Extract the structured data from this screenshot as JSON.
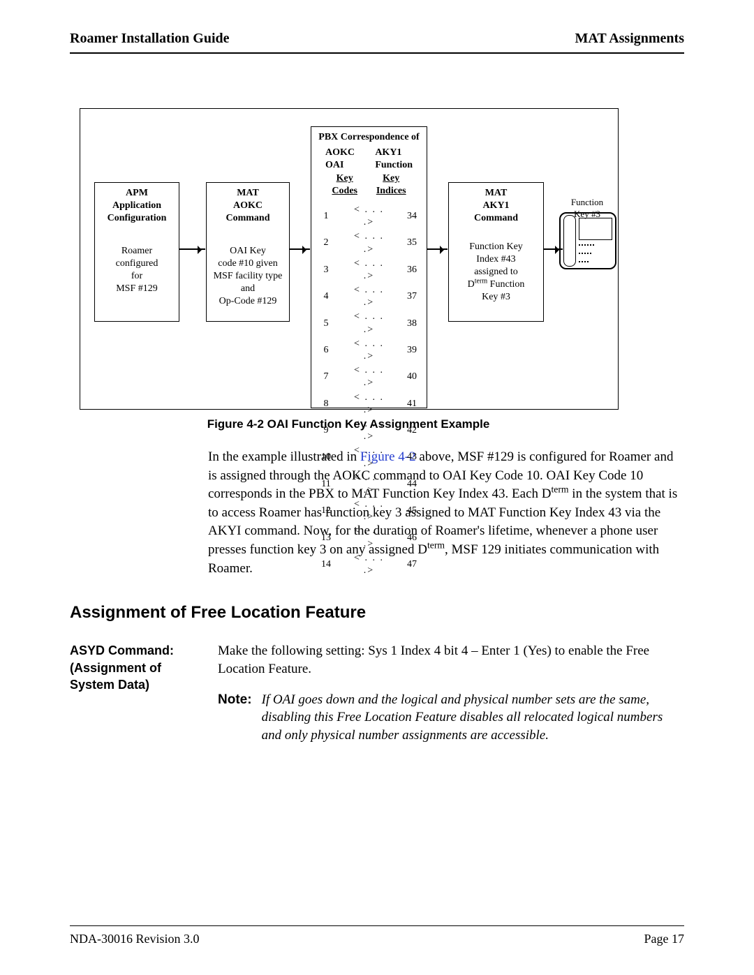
{
  "header": {
    "left": "Roamer Installation Guide",
    "right": "MAT Assignments"
  },
  "diagram": {
    "box1": {
      "t": "APM",
      "s1": "Application",
      "s2": "Configuration",
      "p1": "Roamer",
      "p2": "configured",
      "p3": "for",
      "p4": "MSF #129"
    },
    "box2": {
      "t": "MAT",
      "s1": "AOKC",
      "s2": "Command",
      "p1": "OAI Key",
      "p2": "code #10 given",
      "p3": "MSF facility type",
      "p4": "and",
      "p5": "Op-Code #129"
    },
    "box3": {
      "head": "PBX Correspondence of",
      "left_t1": "AOKC",
      "left_t2": "OAI",
      "right_t1": "AKY1",
      "right_t2": "Function",
      "left_u": "Key Codes",
      "right_u": "Key Indices",
      "rows": [
        [
          "1",
          "< . . . .>",
          "34"
        ],
        [
          "2",
          "< . . . .>",
          "35"
        ],
        [
          "3",
          "< . . . .>",
          "36"
        ],
        [
          "4",
          "< . . . .>",
          "37"
        ],
        [
          "5",
          "< . . . .>",
          "38"
        ],
        [
          "6",
          "< . . . .>",
          "39"
        ],
        [
          "7",
          "< . . . .>",
          "40"
        ],
        [
          "8",
          "< . . . .>",
          "41"
        ],
        [
          "9",
          "< . . . .>",
          "42"
        ],
        [
          "10",
          "< . . . .>",
          "43"
        ],
        [
          "11",
          "< . . . .>",
          "44"
        ],
        [
          "12",
          "< . . . .>",
          "45"
        ],
        [
          "13",
          "< . . . .>",
          "46"
        ],
        [
          "14",
          "< . . . .>",
          "47"
        ]
      ]
    },
    "box4": {
      "t": "MAT",
      "s1": "AKY1",
      "s2": "Command",
      "p1": "Function Key",
      "p2": "Index #43",
      "p3": "assigned to",
      "p4_before": "D",
      "p4_sup": "term",
      "p4_after": " Function",
      "p5": "Key #3"
    },
    "dterm_label": "Function\nKey #3"
  },
  "figure_caption": "Figure 4-2   OAI Function Key Assignment Example",
  "paragraph": {
    "seg1a": "In the example illustrated in ",
    "link": "Figure 4-2",
    "seg1b": " above, MSF #129 is configured for Roamer and is assigned through the AOKC command to OAI Key Code 10. OAI Key Code 10 corresponds in the PBX to MAT Function Key Index 43. Each D",
    "seg1sup": "term",
    "seg1c": " in the system that is to access Roamer has function key 3 assigned to MAT Function Key Index 43 via the AKYI command. Now, for the duration of Roamer's lifetime, whenever a phone user presses function key 3 on any assigned D",
    "seg1sup2": "term",
    "seg1d": ", MSF 129 initiates communication with Roamer."
  },
  "section_heading": "Assignment of Free Location Feature",
  "left_stub": {
    "l1": "ASYD Command:",
    "l2": "(Assignment of",
    "l3": "System Data)"
  },
  "asyd_text": "Make the following setting: Sys 1 Index 4 bit 4 – Enter 1 (Yes) to enable the Free Location Feature.",
  "note": {
    "label": "Note:",
    "text": "If OAI goes down and the logical and physical number sets are the same, disabling this Free Location Feature disables all relocated logical numbers and only physical number assignments are accessible."
  },
  "footer": {
    "left": "NDA-30016   Revision 3.0",
    "right": "Page 17"
  }
}
